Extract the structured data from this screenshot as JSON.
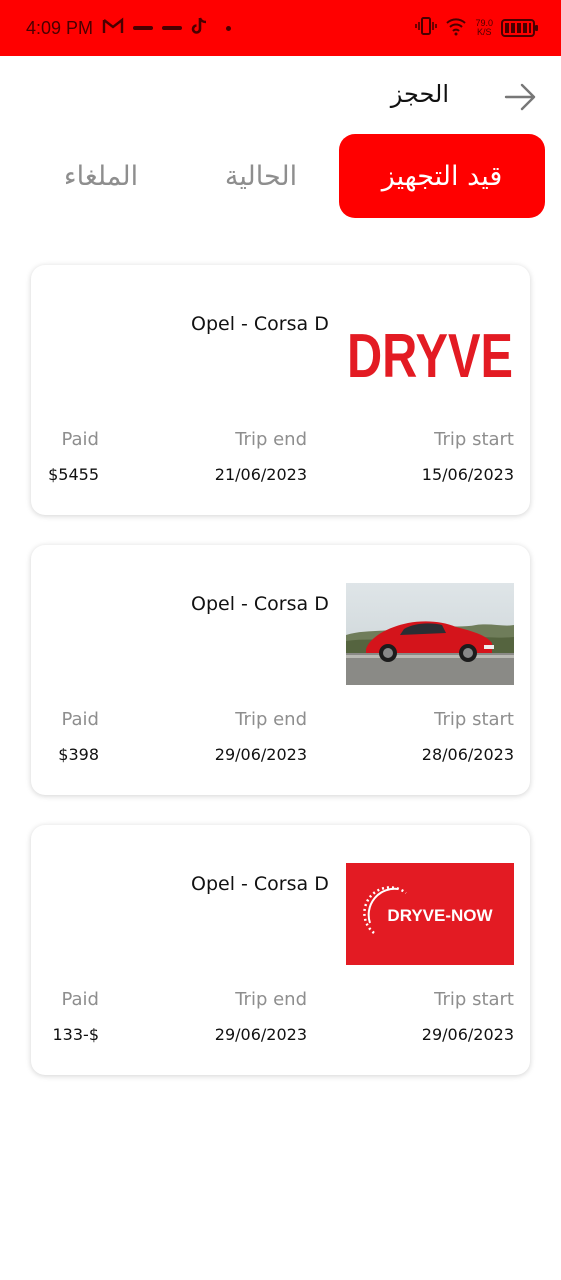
{
  "status_bar": {
    "time": "4:09 PM",
    "speed_value": "79.0",
    "speed_unit": "K/S"
  },
  "header": {
    "title": "الحجز"
  },
  "tabs": [
    {
      "label": "قيد التجهيز",
      "active": true
    },
    {
      "label": "الحالية",
      "active": false
    },
    {
      "label": "الملغاء",
      "active": false
    }
  ],
  "labels": {
    "trip_start": "Trip start",
    "trip_end": "Trip end",
    "paid": "Paid"
  },
  "bookings": [
    {
      "car": "Opel - Corsa D",
      "image": "dryve-logo",
      "image_text": "DRYVE",
      "trip_start": "15/06/2023",
      "trip_end": "21/06/2023",
      "paid": "$5455"
    },
    {
      "car": "Opel - Corsa D",
      "image": "red-sports-car-photo",
      "trip_start": "28/06/2023",
      "trip_end": "29/06/2023",
      "paid": "$398"
    },
    {
      "car": "Opel - Corsa D",
      "image": "dryve-now-logo",
      "image_text": "DRYVE-NOW",
      "trip_start": "29/06/2023",
      "trip_end": "29/06/2023",
      "paid": "133-$"
    }
  ],
  "colors": {
    "accent": "#ff0000",
    "muted_text": "#8e8e8e",
    "logo_red": "#e31b23"
  }
}
